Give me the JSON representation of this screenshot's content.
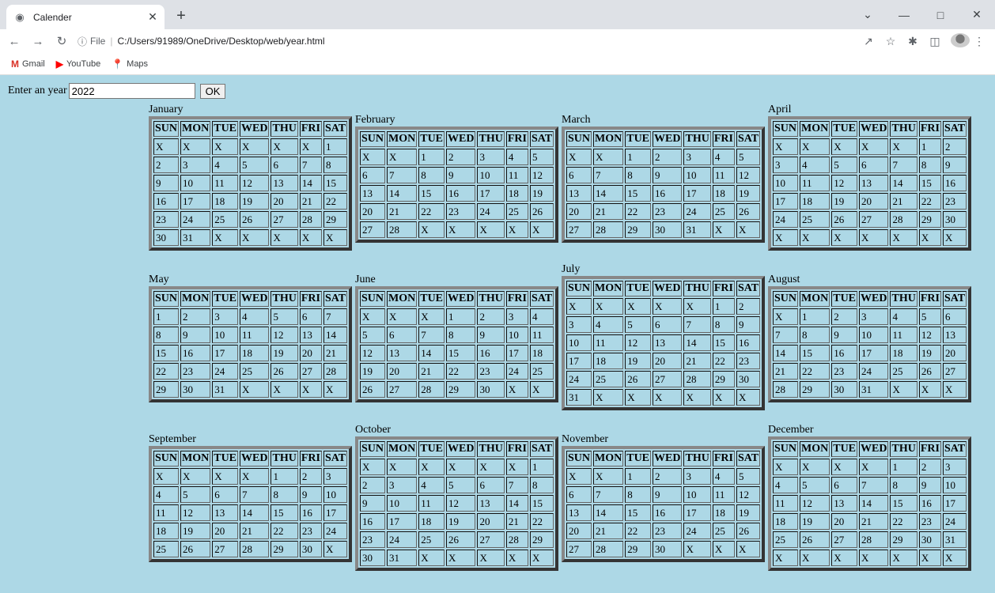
{
  "browser": {
    "tab_title": "Calender",
    "new_tab": "+",
    "address": "C:/Users/91989/OneDrive/Desktop/web/year.html",
    "protocol_label": "File",
    "bookmarks": [
      {
        "label": "Gmail",
        "icon": "gmail-icon",
        "glyph": "M",
        "color": "#d93025"
      },
      {
        "label": "YouTube",
        "icon": "youtube-icon",
        "glyph": "▶",
        "color": "#ff0000"
      },
      {
        "label": "Maps",
        "icon": "maps-icon",
        "glyph": "📍",
        "color": "#34a853"
      }
    ]
  },
  "form": {
    "label": "Enter an year",
    "year_value": "2022",
    "ok_label": "OK"
  },
  "days": [
    "SUN",
    "MON",
    "TUE",
    "WED",
    "THU",
    "FRI",
    "SAT"
  ],
  "months": [
    {
      "name": "January",
      "weeks": [
        [
          "X",
          "X",
          "X",
          "X",
          "X",
          "X",
          "1"
        ],
        [
          "2",
          "3",
          "4",
          "5",
          "6",
          "7",
          "8"
        ],
        [
          "9",
          "10",
          "11",
          "12",
          "13",
          "14",
          "15"
        ],
        [
          "16",
          "17",
          "18",
          "19",
          "20",
          "21",
          "22"
        ],
        [
          "23",
          "24",
          "25",
          "26",
          "27",
          "28",
          "29"
        ],
        [
          "30",
          "31",
          "X",
          "X",
          "X",
          "X",
          "X"
        ]
      ]
    },
    {
      "name": "February",
      "weeks": [
        [
          "X",
          "X",
          "1",
          "2",
          "3",
          "4",
          "5"
        ],
        [
          "6",
          "7",
          "8",
          "9",
          "10",
          "11",
          "12"
        ],
        [
          "13",
          "14",
          "15",
          "16",
          "17",
          "18",
          "19"
        ],
        [
          "20",
          "21",
          "22",
          "23",
          "24",
          "25",
          "26"
        ],
        [
          "27",
          "28",
          "X",
          "X",
          "X",
          "X",
          "X"
        ]
      ]
    },
    {
      "name": "March",
      "weeks": [
        [
          "X",
          "X",
          "1",
          "2",
          "3",
          "4",
          "5"
        ],
        [
          "6",
          "7",
          "8",
          "9",
          "10",
          "11",
          "12"
        ],
        [
          "13",
          "14",
          "15",
          "16",
          "17",
          "18",
          "19"
        ],
        [
          "20",
          "21",
          "22",
          "23",
          "24",
          "25",
          "26"
        ],
        [
          "27",
          "28",
          "29",
          "30",
          "31",
          "X",
          "X"
        ]
      ]
    },
    {
      "name": "April",
      "weeks": [
        [
          "X",
          "X",
          "X",
          "X",
          "X",
          "1",
          "2"
        ],
        [
          "3",
          "4",
          "5",
          "6",
          "7",
          "8",
          "9"
        ],
        [
          "10",
          "11",
          "12",
          "13",
          "14",
          "15",
          "16"
        ],
        [
          "17",
          "18",
          "19",
          "20",
          "21",
          "22",
          "23"
        ],
        [
          "24",
          "25",
          "26",
          "27",
          "28",
          "29",
          "30"
        ],
        [
          "X",
          "X",
          "X",
          "X",
          "X",
          "X",
          "X"
        ]
      ]
    },
    {
      "name": "May",
      "weeks": [
        [
          "1",
          "2",
          "3",
          "4",
          "5",
          "6",
          "7"
        ],
        [
          "8",
          "9",
          "10",
          "11",
          "12",
          "13",
          "14"
        ],
        [
          "15",
          "16",
          "17",
          "18",
          "19",
          "20",
          "21"
        ],
        [
          "22",
          "23",
          "24",
          "25",
          "26",
          "27",
          "28"
        ],
        [
          "29",
          "30",
          "31",
          "X",
          "X",
          "X",
          "X"
        ]
      ]
    },
    {
      "name": "June",
      "weeks": [
        [
          "X",
          "X",
          "X",
          "1",
          "2",
          "3",
          "4"
        ],
        [
          "5",
          "6",
          "7",
          "8",
          "9",
          "10",
          "11"
        ],
        [
          "12",
          "13",
          "14",
          "15",
          "16",
          "17",
          "18"
        ],
        [
          "19",
          "20",
          "21",
          "22",
          "23",
          "24",
          "25"
        ],
        [
          "26",
          "27",
          "28",
          "29",
          "30",
          "X",
          "X"
        ]
      ]
    },
    {
      "name": "July",
      "weeks": [
        [
          "X",
          "X",
          "X",
          "X",
          "X",
          "1",
          "2"
        ],
        [
          "3",
          "4",
          "5",
          "6",
          "7",
          "8",
          "9"
        ],
        [
          "10",
          "11",
          "12",
          "13",
          "14",
          "15",
          "16"
        ],
        [
          "17",
          "18",
          "19",
          "20",
          "21",
          "22",
          "23"
        ],
        [
          "24",
          "25",
          "26",
          "27",
          "28",
          "29",
          "30"
        ],
        [
          "31",
          "X",
          "X",
          "X",
          "X",
          "X",
          "X"
        ]
      ]
    },
    {
      "name": "August",
      "weeks": [
        [
          "X",
          "1",
          "2",
          "3",
          "4",
          "5",
          "6"
        ],
        [
          "7",
          "8",
          "9",
          "10",
          "11",
          "12",
          "13"
        ],
        [
          "14",
          "15",
          "16",
          "17",
          "18",
          "19",
          "20"
        ],
        [
          "21",
          "22",
          "23",
          "24",
          "25",
          "26",
          "27"
        ],
        [
          "28",
          "29",
          "30",
          "31",
          "X",
          "X",
          "X"
        ]
      ]
    },
    {
      "name": "September",
      "weeks": [
        [
          "X",
          "X",
          "X",
          "X",
          "1",
          "2",
          "3"
        ],
        [
          "4",
          "5",
          "6",
          "7",
          "8",
          "9",
          "10"
        ],
        [
          "11",
          "12",
          "13",
          "14",
          "15",
          "16",
          "17"
        ],
        [
          "18",
          "19",
          "20",
          "21",
          "22",
          "23",
          "24"
        ],
        [
          "25",
          "26",
          "27",
          "28",
          "29",
          "30",
          "X"
        ]
      ]
    },
    {
      "name": "October",
      "weeks": [
        [
          "X",
          "X",
          "X",
          "X",
          "X",
          "X",
          "1"
        ],
        [
          "2",
          "3",
          "4",
          "5",
          "6",
          "7",
          "8"
        ],
        [
          "9",
          "10",
          "11",
          "12",
          "13",
          "14",
          "15"
        ],
        [
          "16",
          "17",
          "18",
          "19",
          "20",
          "21",
          "22"
        ],
        [
          "23",
          "24",
          "25",
          "26",
          "27",
          "28",
          "29"
        ],
        [
          "30",
          "31",
          "X",
          "X",
          "X",
          "X",
          "X"
        ]
      ]
    },
    {
      "name": "November",
      "weeks": [
        [
          "X",
          "X",
          "1",
          "2",
          "3",
          "4",
          "5"
        ],
        [
          "6",
          "7",
          "8",
          "9",
          "10",
          "11",
          "12"
        ],
        [
          "13",
          "14",
          "15",
          "16",
          "17",
          "18",
          "19"
        ],
        [
          "20",
          "21",
          "22",
          "23",
          "24",
          "25",
          "26"
        ],
        [
          "27",
          "28",
          "29",
          "30",
          "X",
          "X",
          "X"
        ]
      ]
    },
    {
      "name": "December",
      "weeks": [
        [
          "X",
          "X",
          "X",
          "X",
          "1",
          "2",
          "3"
        ],
        [
          "4",
          "5",
          "6",
          "7",
          "8",
          "9",
          "10"
        ],
        [
          "11",
          "12",
          "13",
          "14",
          "15",
          "16",
          "17"
        ],
        [
          "18",
          "19",
          "20",
          "21",
          "22",
          "23",
          "24"
        ],
        [
          "25",
          "26",
          "27",
          "28",
          "29",
          "30",
          "31"
        ],
        [
          "X",
          "X",
          "X",
          "X",
          "X",
          "X",
          "X"
        ]
      ]
    }
  ]
}
